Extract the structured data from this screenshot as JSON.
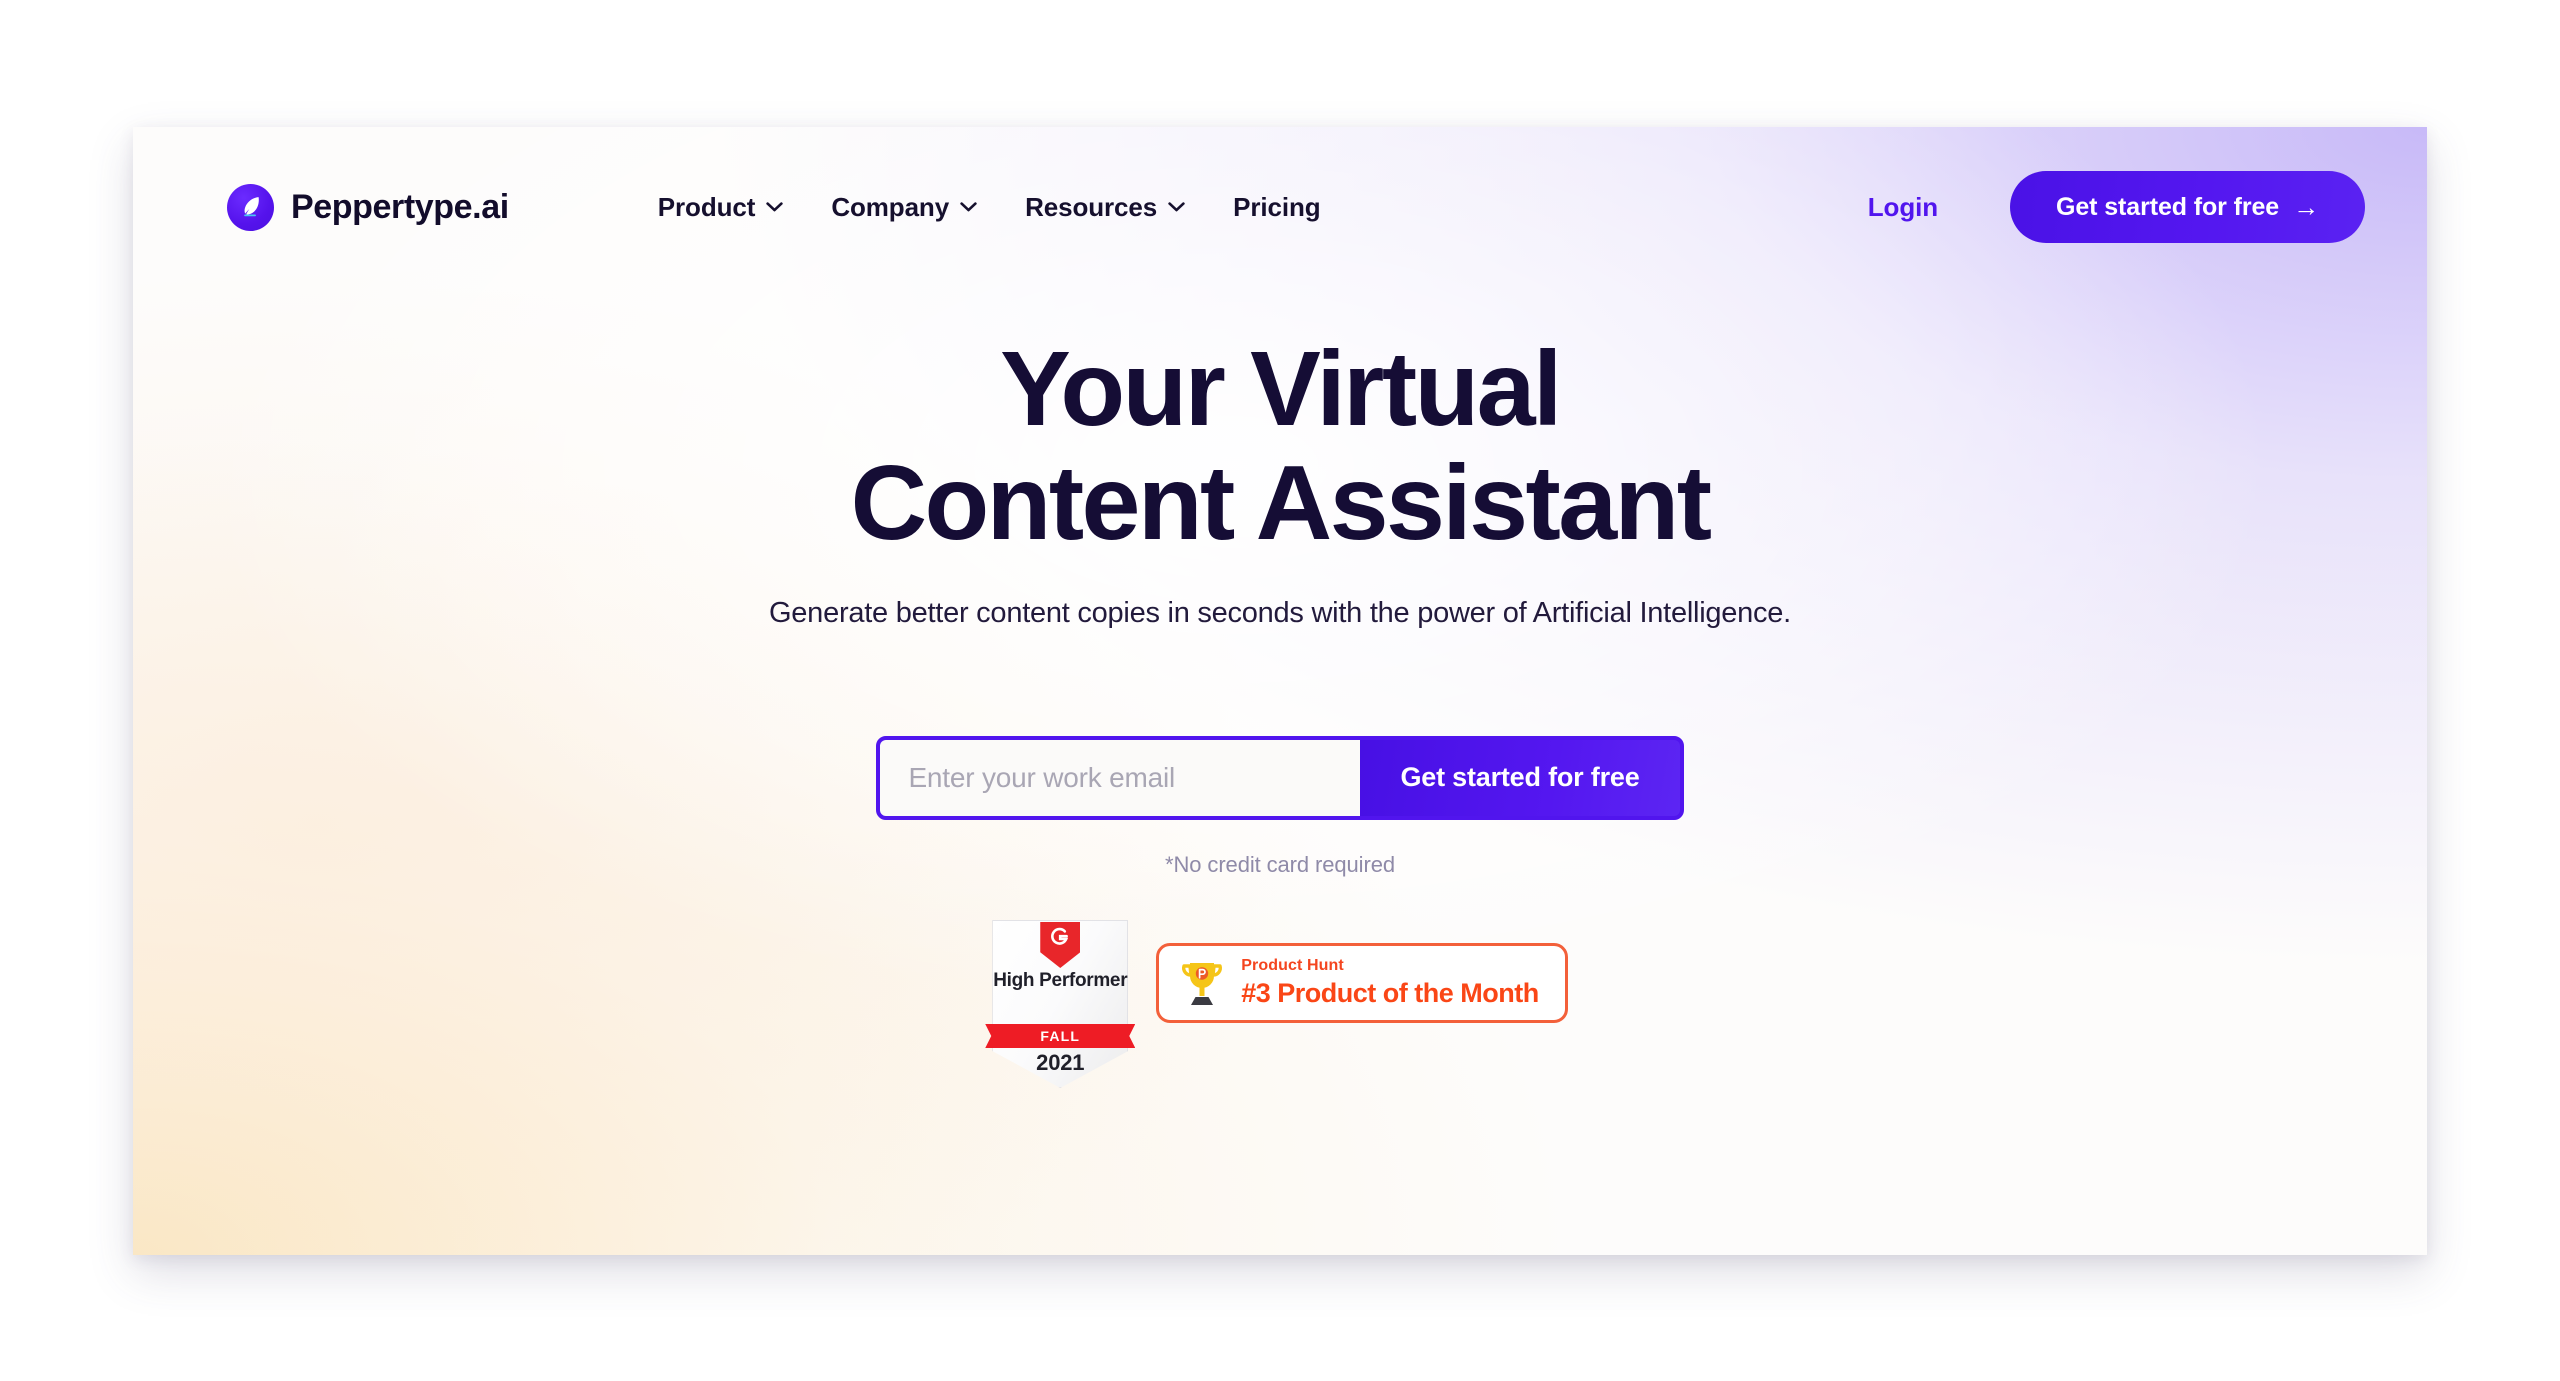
{
  "brand": {
    "name": "Peppertype.ai",
    "logo_icon": "feather-quill-icon",
    "logo_bg_color": "#5513ec"
  },
  "nav": {
    "items": [
      {
        "label": "Product",
        "icon": "chevron-down-icon",
        "has_dropdown": true
      },
      {
        "label": "Company",
        "icon": "chevron-down-icon",
        "has_dropdown": true
      },
      {
        "label": "Resources",
        "icon": "chevron-down-icon",
        "has_dropdown": true
      },
      {
        "label": "Pricing",
        "icon": "",
        "has_dropdown": false
      }
    ],
    "login_label": "Login",
    "login_color": "#5115ee",
    "cta_label": "Get started for free",
    "cta_arrow": "→",
    "cta_bg_color": "#5115ee"
  },
  "hero": {
    "headline_line_1": "Your Virtual",
    "headline_line_2": "Content Assistant",
    "headline_color": "#150d35",
    "subtitle": "Generate better content copies in seconds with the power of Artificial Intelligence."
  },
  "signup": {
    "email_placeholder": "Enter your work email",
    "email_value": "",
    "submit_label": "Get started for free",
    "note": "*No credit card required",
    "accent_color": "#5115ee"
  },
  "badges": {
    "g2": {
      "logo_icon": "g2-logo-icon",
      "title": "High Performer",
      "season": "FALL",
      "year": "2021",
      "ribbon_color": "#ee1c25"
    },
    "product_hunt": {
      "icon": "trophy-icon",
      "kicker": "Product Hunt",
      "title": "#3 Product of the Month",
      "accent_color": "#fa4616"
    }
  }
}
